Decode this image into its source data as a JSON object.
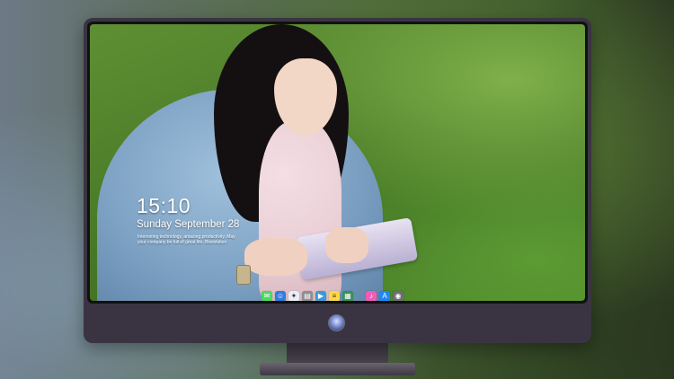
{
  "lockscreen": {
    "time": "15:10",
    "date": "Sunday September 28",
    "note_line1": "Interesting technology, amazing productivity. May",
    "note_line2": "your company be full of great life. Bissolution"
  },
  "dock": {
    "icons": [
      {
        "name": "messages-icon",
        "color": "#4cd964",
        "glyph": "✉"
      },
      {
        "name": "finder-icon",
        "color": "#2f7de1",
        "glyph": "☺"
      },
      {
        "name": "safari-icon",
        "color": "#e8eef5",
        "glyph": "✦"
      },
      {
        "name": "keynote-icon",
        "color": "#8e8e93",
        "glyph": "▤"
      },
      {
        "name": "media-icon",
        "color": "#3a9bd8",
        "glyph": "▶"
      },
      {
        "name": "notes-icon",
        "color": "#ffd84a",
        "glyph": "≡"
      },
      {
        "name": "image-icon",
        "color": "#3b8f5a",
        "glyph": "▦"
      },
      {
        "name": "itunes-icon",
        "color": "#f25cb8",
        "glyph": "♪"
      },
      {
        "name": "appstore-icon",
        "color": "#1e88f5",
        "glyph": "A"
      },
      {
        "name": "camera-icon",
        "color": "#6d6d72",
        "glyph": "◉"
      }
    ]
  },
  "colors": {
    "monitor_body": "#3a3442",
    "stand": "#4a4552"
  }
}
